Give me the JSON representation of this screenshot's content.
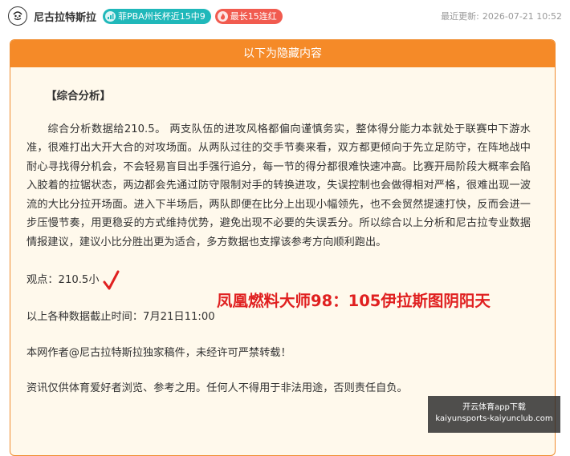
{
  "header": {
    "author": "尼古拉特斯拉",
    "badge_streak_recent": "菲PBA州长杯近15中9",
    "badge_streak_longest": "最长15连红",
    "update_label": "最近更新:",
    "update_time": "2026-07-21 10:52"
  },
  "panel": {
    "header": "以下为隐藏内容",
    "section_title": "【综合分析】",
    "analysis": "综合分析数据给210.5。 两支队伍的进攻风格都偏向谨慎务实，整体得分能力本就处于联赛中下游水准，很难打出大开大合的对攻场面。从两队过往的交手节奏来看，双方都更倾向于先立足防守，在阵地战中耐心寻找得分机会，不会轻易盲目出手强行追分，每一节的得分都很难快速冲高。比赛开局阶段大概率会陷入胶着的拉锯状态，两边都会先通过防守限制对手的转换进攻，失误控制也会做得相对严格，很难出现一波流的大比分拉开场面。进入下半场后，两队即便在比分上出现小幅领先，也不会贸然提速打快，反而会进一步压慢节奏，用更稳妥的方式维持优势，避免出现不必要的失误丢分。所以综合以上分析和尼古拉专业数据情报建议，建议小比分胜出更为适合，多方数据也支撑该参考方向顺利跑出。",
    "viewpoint": "观点：210.5小",
    "cutoff": "以上各种数据截止时间：7月21日11:00",
    "copyright": "本网作者@尼古拉特斯拉独家稿件，未经许可严禁转载！",
    "disclaimer": "资讯仅供体育爱好者浏览、参考之用。任何人不得用于非法用途，否则责任自负。"
  },
  "overlay_text": "凤凰燃料大师98：105伊拉斯图阴阳天",
  "watermark": {
    "line1": "开云体育app下载",
    "line2": "kaiyunsports-kaiyunclub.com"
  },
  "colors": {
    "accent_orange": "#f58a28",
    "badge_teal": "#20b8ba",
    "badge_red": "#f15b4f",
    "overlay_red": "#e02020"
  }
}
